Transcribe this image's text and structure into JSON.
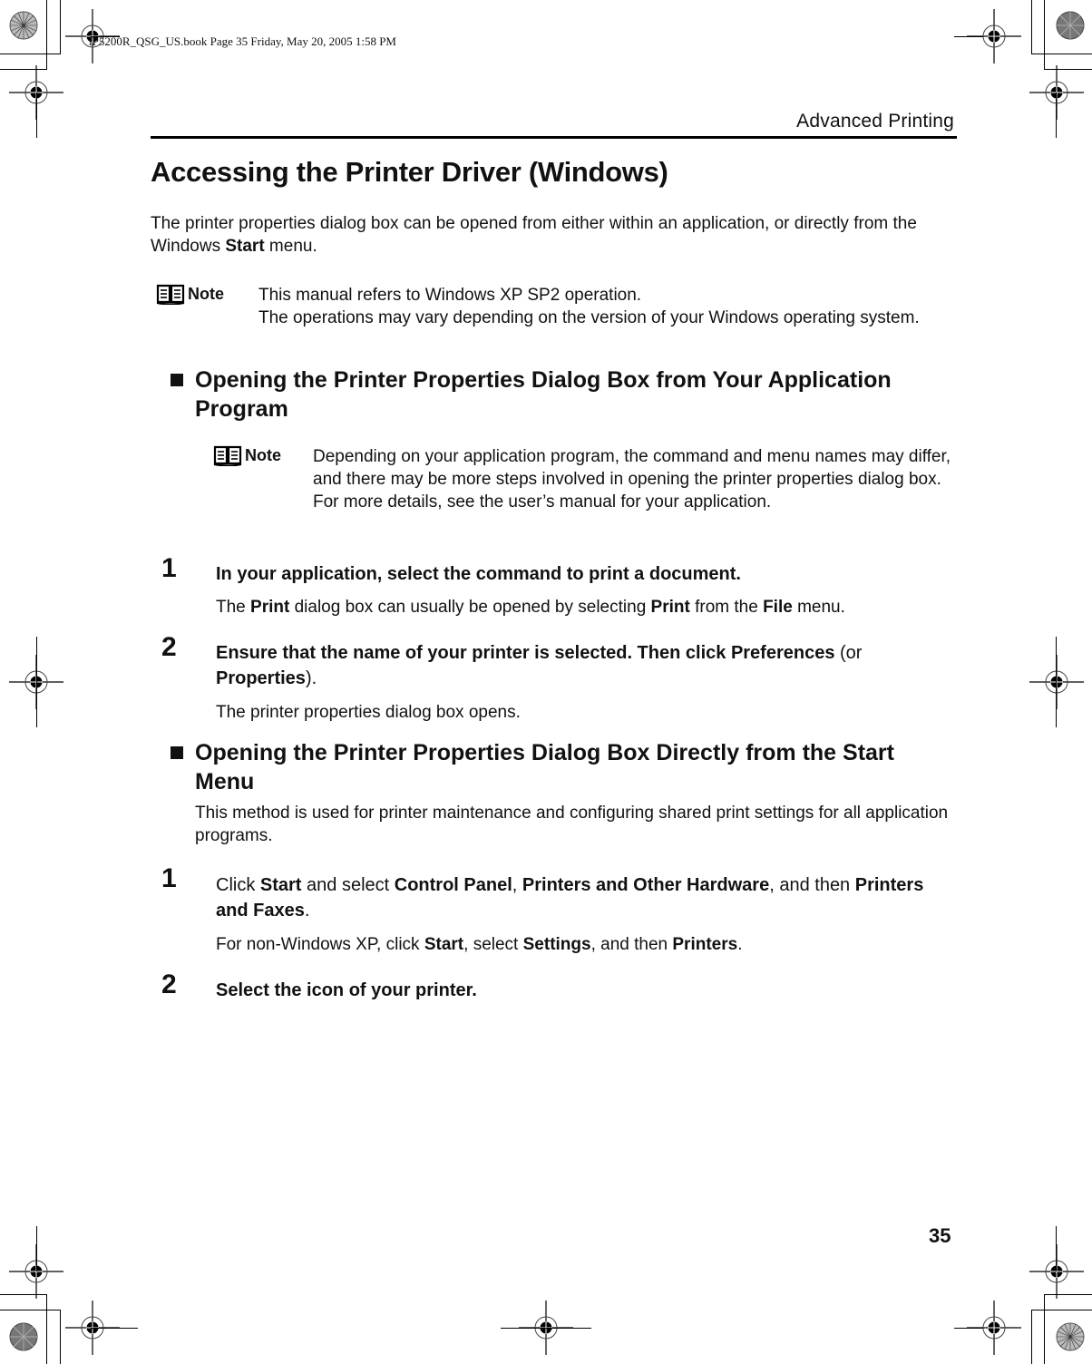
{
  "book_info": "iP5200R_QSG_US.book  Page 35  Friday, May 20, 2005  1:58 PM",
  "running_head": "Advanced Printing",
  "title": "Accessing the Printer Driver (Windows)",
  "intro": {
    "part1": "The printer properties dialog box can be opened from either within an application, or directly from the Windows ",
    "bold1": "Start",
    "part2": " menu."
  },
  "note1": {
    "label": "Note",
    "line1": "This manual refers to Windows XP SP2 operation.",
    "line2": "The operations may vary depending on the version of your Windows operating system."
  },
  "section1": {
    "heading": "Opening the Printer Properties Dialog Box from Your Application Program",
    "note": {
      "label": "Note",
      "text": "Depending on your application program, the command and menu names may differ, and there may be more steps involved in opening the printer properties dialog box. For more details, see the user’s manual for your application."
    },
    "steps": [
      {
        "number": "1",
        "title": "In your application, select the command to print a document.",
        "sub": {
          "t1": "The ",
          "b1": "Print",
          "t2": " dialog box can usually be opened by selecting ",
          "b2": "Print",
          "t3": " from the ",
          "b3": "File",
          "t4": " menu."
        }
      },
      {
        "number": "2",
        "title_part1": "Ensure that the name of your printer is selected. Then click ",
        "title_bold1": "Preferences",
        "title_part2": " (or ",
        "title_bold2": "Properties",
        "title_part3": ").",
        "sub": "The printer properties dialog box opens."
      }
    ]
  },
  "section2": {
    "heading": "Opening the Printer Properties Dialog Box Directly from the Start Menu",
    "description": "This method is used for printer maintenance and configuring shared print settings for all application programs.",
    "steps": [
      {
        "number": "1",
        "t1": "Click ",
        "b1": "Start",
        "t2": " and select ",
        "b2": "Control Panel",
        "t3": ", ",
        "b3": "Printers and Other Hardware",
        "t4": ", and then ",
        "b4": "Printers and Faxes",
        "t5": ".",
        "sub": {
          "t1": "For non-Windows XP, click ",
          "b1": "Start",
          "t2": ", select ",
          "b2": "Settings",
          "t3": ", and then ",
          "b3": "Printers",
          "t4": "."
        }
      },
      {
        "number": "2",
        "title": "Select the icon of your printer."
      }
    ]
  },
  "page_number": "35"
}
